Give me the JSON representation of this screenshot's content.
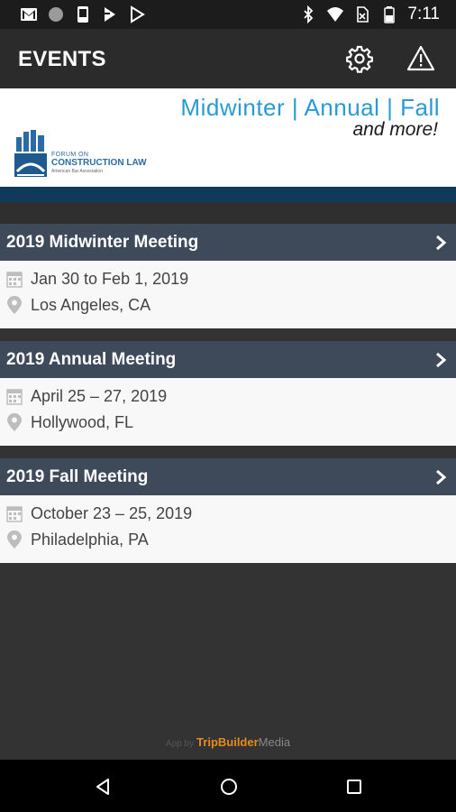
{
  "status_bar": {
    "time": "7:11",
    "left_icons": [
      "gmail-icon",
      "circle-icon",
      "phone-icon",
      "flag-icon",
      "play-icon"
    ],
    "right_icons": [
      "bluetooth-icon",
      "wifi-icon",
      "no-sim-icon",
      "battery-icon"
    ]
  },
  "app_bar": {
    "title": "EVENTS",
    "settings_icon": "gear-icon",
    "alert_icon": "warning-icon"
  },
  "banner": {
    "line1": "Midwinter | Annual | Fall",
    "line2": "and more!",
    "logo": {
      "line1": "FORUM ON",
      "line2": "CONSTRUCTION LAW",
      "line3": "American Bar Association"
    }
  },
  "events": [
    {
      "title": "2019 Midwinter Meeting",
      "date": "Jan 30 to Feb 1, 2019",
      "location": "Los Angeles, CA"
    },
    {
      "title": "2019 Annual Meeting",
      "date": "April 25 – 27, 2019",
      "location": "Hollywood, FL"
    },
    {
      "title": "2019 Fall Meeting",
      "date": "October 23 – 25, 2019",
      "location": "Philadelphia, PA"
    }
  ],
  "footer": {
    "prefix": "App by",
    "brand_highlight": "TripBuilder",
    "brand_rest": "Media"
  },
  "colors": {
    "accent_blue": "#2a9bd2",
    "header_bar": "#3e4a5a",
    "brand_orange": "#e88a1a"
  }
}
